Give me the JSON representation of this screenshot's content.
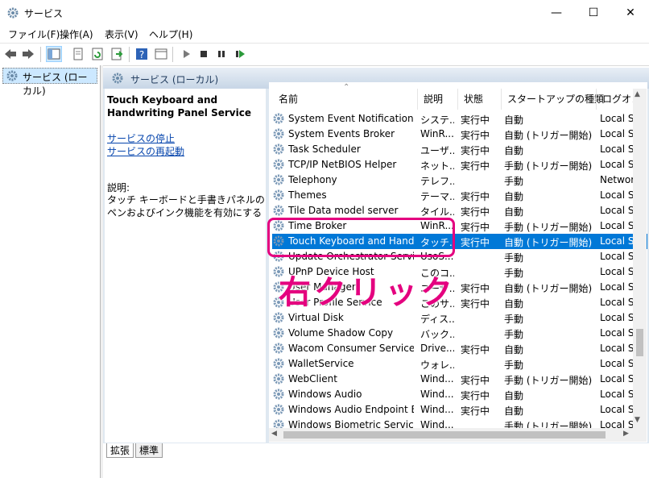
{
  "window": {
    "title": "サービス",
    "minimize": "—",
    "maximize": "☐",
    "close": "✕"
  },
  "menu": [
    "ファイル(F)",
    "操作(A)",
    "表示(V)",
    "ヘルプ(H)"
  ],
  "tree": {
    "item": "サービス (ローカル)"
  },
  "panel": {
    "header": "サービス (ローカル)"
  },
  "detail": {
    "service_name": "Touch Keyboard and Handwriting Panel Service",
    "stop_link": "サービスの停止",
    "restart_link": "サービスの再起動",
    "desc_label": "説明:",
    "description": "タッチ キーボードと手書きパネルのペンおよびインク機能を有効にする"
  },
  "columns": [
    "名前",
    "説明",
    "状態",
    "スタートアップの種類",
    "ログオン"
  ],
  "rows": [
    {
      "name": "System Event Notification S...",
      "desc": "システ...",
      "status": "実行中",
      "startup": "自動",
      "logon": "Local S"
    },
    {
      "name": "System Events Broker",
      "desc": "WinR...",
      "status": "実行中",
      "startup": "自動 (トリガー開始)",
      "logon": "Local S"
    },
    {
      "name": "Task Scheduler",
      "desc": "ユーザ...",
      "status": "実行中",
      "startup": "自動",
      "logon": "Local S"
    },
    {
      "name": "TCP/IP NetBIOS Helper",
      "desc": "ネット...",
      "status": "実行中",
      "startup": "手動 (トリガー開始)",
      "logon": "Local S"
    },
    {
      "name": "Telephony",
      "desc": "テレフ...",
      "status": "",
      "startup": "手動",
      "logon": "Networ"
    },
    {
      "name": "Themes",
      "desc": "テーマ...",
      "status": "実行中",
      "startup": "自動",
      "logon": "Local S"
    },
    {
      "name": "Tile Data model server",
      "desc": "タイル...",
      "status": "実行中",
      "startup": "自動",
      "logon": "Local S"
    },
    {
      "name": "Time Broker",
      "desc": "WinR...",
      "status": "実行中",
      "startup": "手動 (トリガー開始)",
      "logon": "Local S"
    },
    {
      "name": "Touch Keyboard and Hand...",
      "desc": "タッチ...",
      "status": "実行中",
      "startup": "自動 (トリガー開始)",
      "logon": "Local S",
      "selected": true
    },
    {
      "name": "Update Orchestrator Service",
      "desc": "UsoS...",
      "status": "",
      "startup": "手動",
      "logon": "Local S"
    },
    {
      "name": "UPnP Device Host",
      "desc": "このコ...",
      "status": "",
      "startup": "手動",
      "logon": "Local S"
    },
    {
      "name": "User Manager",
      "desc": "ユーザ...",
      "status": "実行中",
      "startup": "自動 (トリガー開始)",
      "logon": "Local S"
    },
    {
      "name": "User Profile Service",
      "desc": "このサ...",
      "status": "実行中",
      "startup": "自動",
      "logon": "Local S"
    },
    {
      "name": "Virtual Disk",
      "desc": "ディス...",
      "status": "",
      "startup": "手動",
      "logon": "Local S"
    },
    {
      "name": "Volume Shadow Copy",
      "desc": "バック...",
      "status": "",
      "startup": "手動",
      "logon": "Local S"
    },
    {
      "name": "Wacom Consumer Service",
      "desc": "Drive...",
      "status": "実行中",
      "startup": "自動",
      "logon": "Local S"
    },
    {
      "name": "WalletService",
      "desc": "ウォレ...",
      "status": "",
      "startup": "手動",
      "logon": "Local S"
    },
    {
      "name": "WebClient",
      "desc": "Wind...",
      "status": "実行中",
      "startup": "手動 (トリガー開始)",
      "logon": "Local S"
    },
    {
      "name": "Windows Audio",
      "desc": "Wind...",
      "status": "実行中",
      "startup": "自動",
      "logon": "Local S"
    },
    {
      "name": "Windows Audio Endpoint B...",
      "desc": "Wind...",
      "status": "実行中",
      "startup": "自動",
      "logon": "Local S"
    },
    {
      "name": "Windows Biometric Service",
      "desc": "Wind...",
      "status": "",
      "startup": "手動 (トリガー開始)",
      "logon": "Local S"
    }
  ],
  "tabs": [
    "拡張",
    "標準"
  ],
  "annotation": {
    "text": "右クリック",
    "color": "#e4007f"
  },
  "colors": {
    "selection": "#0078d7",
    "link": "#0645ad"
  },
  "icons": [
    "services-gear-icon",
    "back-arrow-icon",
    "forward-arrow-icon",
    "play-icon",
    "stop-icon",
    "pause-icon",
    "resume-icon",
    "help-icon"
  ]
}
